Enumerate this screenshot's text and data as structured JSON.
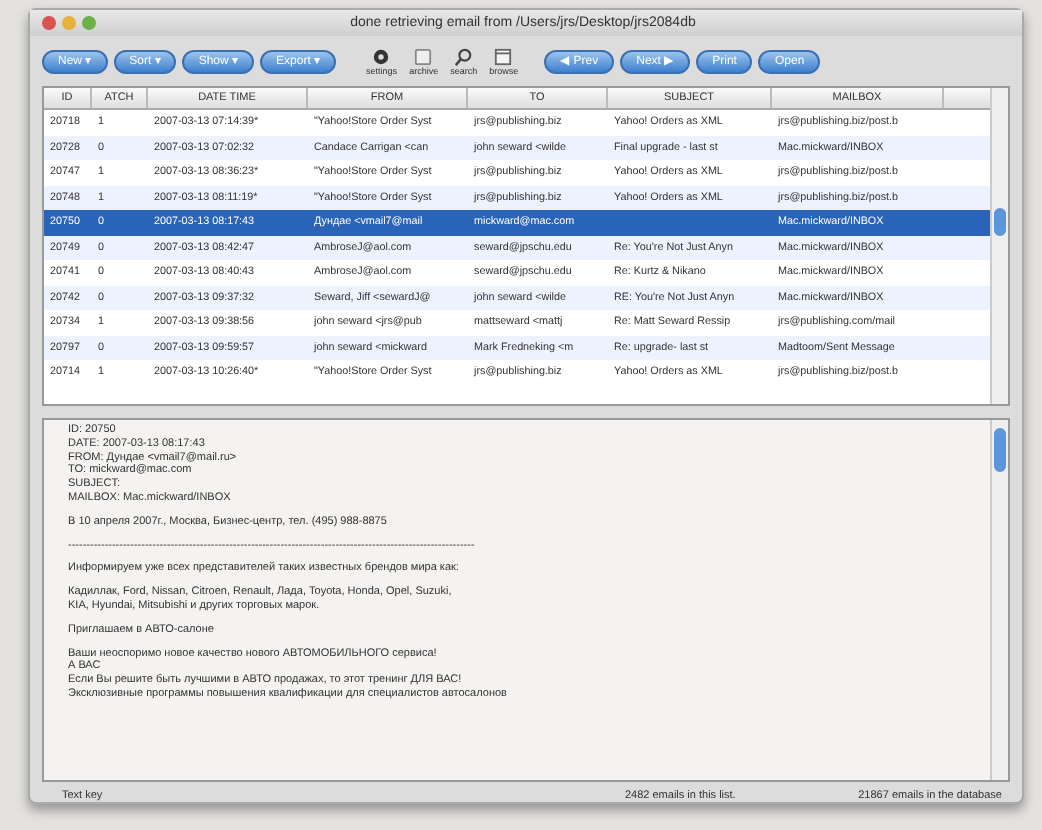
{
  "window": {
    "title": "done retrieving email from /Users/jrs/Desktop/jrs2084db"
  },
  "toolbar": {
    "left_buttons": [
      "New ▾",
      "Sort ▾",
      "Show ▾",
      "Export ▾"
    ],
    "tools": [
      {
        "label": "settings",
        "kind": "gear"
      },
      {
        "label": "archive",
        "kind": "box"
      },
      {
        "label": "search",
        "kind": "search"
      },
      {
        "label": "browse",
        "kind": "window"
      }
    ],
    "right_buttons": [
      "◀ Prev",
      "Next ▶",
      "Print",
      "Open"
    ]
  },
  "table": {
    "columns": [
      "ID",
      "ATCH",
      "DATE TIME",
      "FROM",
      "TO",
      "SUBJECT",
      "MAILBOX"
    ],
    "rows": [
      {
        "cells": [
          "20718",
          "1",
          "2007-03-13 07:14:39*",
          "\"Yahoo!Store Order Syst",
          "jrs@publishing.biz",
          "Yahoo! Orders as XML",
          "jrs@publishing.biz/post.b"
        ],
        "selected": false
      },
      {
        "cells": [
          "20728",
          "0",
          "2007-03-13 07:02:32",
          "Candace Carrigan <can",
          "john seward <wilde",
          "Final upgrade - last st",
          "Mac.mickward/INBOX"
        ],
        "selected": false
      },
      {
        "cells": [
          "20747",
          "1",
          "2007-03-13 08:36:23*",
          "\"Yahoo!Store Order Syst",
          "jrs@publishing.biz",
          "Yahoo! Orders as XML",
          "jrs@publishing.biz/post.b"
        ],
        "selected": false
      },
      {
        "cells": [
          "20748",
          "1",
          "2007-03-13 08:11:19*",
          "\"Yahoo!Store Order Syst",
          "jrs@publishing.biz",
          "Yahoo! Orders as XML",
          "jrs@publishing.biz/post.b"
        ],
        "selected": false
      },
      {
        "cells": [
          "20750",
          "0",
          "2007-03-13 08:17:43",
          "Дундае <vmail7@mail",
          "mickward@mac.com",
          "",
          "Mac.mickward/INBOX"
        ],
        "selected": true
      },
      {
        "cells": [
          "20749",
          "0",
          "2007-03-13 08:42:47",
          "AmbroseJ@aol.com",
          "seward@jpschu.edu",
          "Re: You're Not Just Anyn",
          "Mac.mickward/INBOX"
        ],
        "selected": false
      },
      {
        "cells": [
          "20741",
          "0",
          "2007-03-13 08:40:43",
          "AmbroseJ@aol.com",
          "seward@jpschu.edu",
          "Re: Kurtz & Nikano",
          "Mac.mickward/INBOX"
        ],
        "selected": false
      },
      {
        "cells": [
          "20742",
          "0",
          "2007-03-13 09:37:32",
          "Seward, Jiff <sewardJ@",
          "john seward <wilde",
          "RE: You're Not Just Anyn",
          "Mac.mickward/INBOX"
        ],
        "selected": false
      },
      {
        "cells": [
          "20734",
          "1",
          "2007-03-13 09:38:56",
          "john seward <jrs@pub",
          "mattseward <mattj",
          "Re: Matt Seward Ressip",
          "jrs@publishing.com/mail"
        ],
        "selected": false
      },
      {
        "cells": [
          "20797",
          "0",
          "2007-03-13 09:59:57",
          "john seward <mickward",
          "Mark Fredneking <m",
          "Re: upgrade- last st",
          "Madtoom/Sent Message"
        ],
        "selected": false
      },
      {
        "cells": [
          "20714",
          "1",
          "2007-03-13 10:26:40*",
          "\"Yahoo!Store Order Syst",
          "jrs@publishing.biz",
          "Yahoo! Orders as XML",
          "jrs@publishing.biz/post.b"
        ],
        "selected": false
      }
    ]
  },
  "preview": {
    "header": [
      "ID: 20750",
      "DATE: 2007-03-13 08:17:43",
      "FROM: Дундае <vmail7@mail.ru>",
      "TO: mickward@mac.com",
      "SUBJECT:",
      "MAILBOX: Mac.mickward/INBOX"
    ],
    "paragraphs": [
      [
        "В 10 апреля 2007г., Москва, Бизнес-центр, тел. (495) 988-8875"
      ],
      [
        "---------------------------------------------------------------------------------------------------------------"
      ],
      [
        "Информируем уже всех представителей таких известных брендов мира как:"
      ],
      [
        "Кадиллак, Ford, Nissan, Citroen, Renault, Лада, Toyota, Honda, Opel, Suzuki,",
        "KIA, Hyundai, Mitsubishi и других торговых марок."
      ],
      [
        "Приглашаем в АВТО-салоне"
      ],
      [
        " Ваши неоспоримо новое качество нового АВТОМОБИЛЬНОГО сервиса!",
        "А ВАС",
        "Если Вы решите быть лучшими в АВТО продажах, то этот тренинг ДЛЯ ВАС!",
        "Эксклюзивные программы повышения квалификации для специалистов автосалонов"
      ]
    ]
  },
  "status_bar": {
    "left": "Text key",
    "middle": "2482 emails in this list.",
    "right": "21867 emails in the database"
  }
}
